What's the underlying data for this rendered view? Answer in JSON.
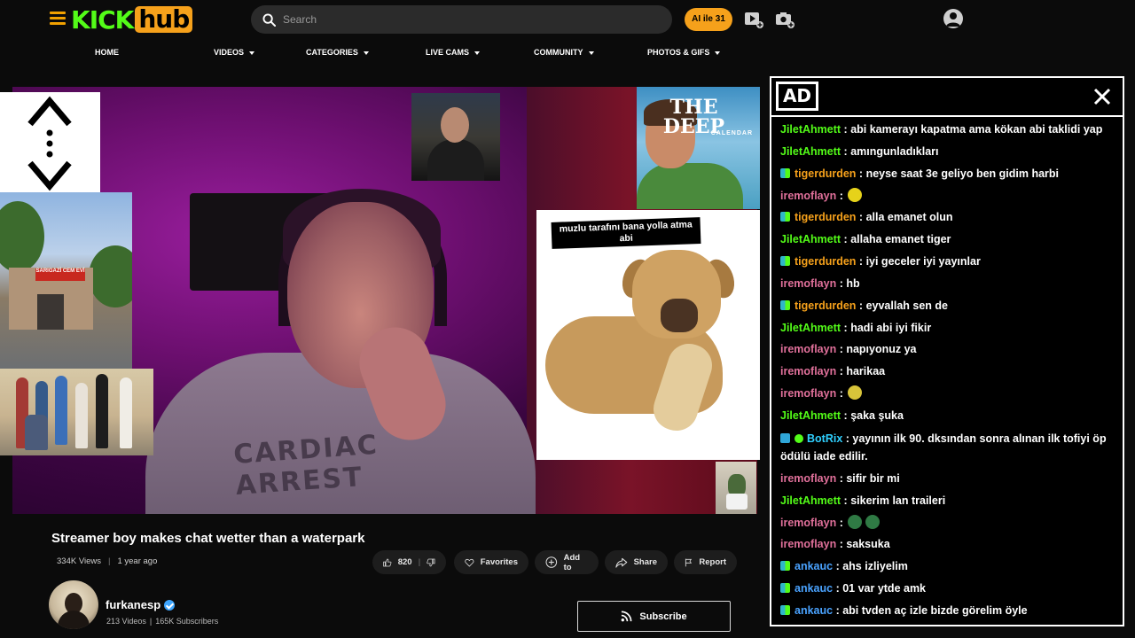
{
  "header": {
    "logo_kick": "KICK",
    "logo_hub": "hub",
    "search_placeholder": "Search",
    "cta_label": "AI ile 31",
    "nav": [
      {
        "label": "HOME",
        "has_caret": false
      },
      {
        "label": "VIDEOS",
        "has_caret": true
      },
      {
        "label": "CATEGORIES",
        "has_caret": true
      },
      {
        "label": "LIVE CAMS",
        "has_caret": true
      },
      {
        "label": "COMMUNITY",
        "has_caret": true
      },
      {
        "label": "PHOTOS & GIFS",
        "has_caret": true
      }
    ],
    "icons": [
      "hamburger-icon",
      "search-icon",
      "video-upload-icon",
      "camera-upload-icon",
      "user-avatar-icon"
    ]
  },
  "video": {
    "shirt_text": "CARDIAC ARREST",
    "overlays": {
      "building_sign": "SARIGAZİ CEM EVİ",
      "poster_title": "THE DEEP",
      "poster_subtitle": "CALENDAR",
      "meme_caption": "muzlu tarafını bana yolla atma abi"
    }
  },
  "details": {
    "title": "Streamer boy makes chat wetter than a waterpark",
    "views": "334K Views",
    "age": "1 year ago",
    "likes": "820",
    "actions": {
      "favorites": "Favorites",
      "add_to": "Add to",
      "share": "Share",
      "report": "Report"
    },
    "channel": {
      "name": "furkanesp",
      "videos": "213 Videos",
      "subscribers": "165K Subscribers",
      "subscribe_label": "Subscribe"
    }
  },
  "chat": {
    "ad_label": "AD",
    "colors": {
      "JiletAhmett": "#53fc18",
      "tigerdurden": "#f6a11b",
      "iremoflayn": "#e0709a",
      "BotRix": "#2fd0ff",
      "ankauc": "#4aa3ff"
    },
    "messages": [
      {
        "user": "JiletAhmett",
        "text": "abi kamerayı kapatma ama kökan abi taklidi yap",
        "badge": ""
      },
      {
        "user": "JiletAhmett",
        "text": "amıngunladıkları",
        "badge": ""
      },
      {
        "user": "tigerdurden",
        "text": "neyse saat 3e geliyo ben gidim harbi",
        "badge": "sub"
      },
      {
        "user": "iremoflayn",
        "text": "",
        "badge": "",
        "emotes": [
          "yellow"
        ]
      },
      {
        "user": "tigerdurden",
        "text": "alla emanet olun",
        "badge": "sub"
      },
      {
        "user": "JiletAhmett",
        "text": "allaha emanet tiger",
        "badge": ""
      },
      {
        "user": "tigerdurden",
        "text": "iyi geceler iyi yayınlar",
        "badge": "sub"
      },
      {
        "user": "iremoflayn",
        "text": "hb",
        "badge": ""
      },
      {
        "user": "tigerdurden",
        "text": "eyvallah sen de",
        "badge": "sub"
      },
      {
        "user": "JiletAhmett",
        "text": "hadi abi iyi fikir",
        "badge": ""
      },
      {
        "user": "iremoflayn",
        "text": "napıyonuz ya",
        "badge": ""
      },
      {
        "user": "iremoflayn",
        "text": "harikaa",
        "badge": ""
      },
      {
        "user": "iremoflayn",
        "text": "",
        "badge": "",
        "emotes": [
          "corn"
        ]
      },
      {
        "user": "JiletAhmett",
        "text": "şaka şuka",
        "badge": ""
      },
      {
        "user": "BotRix",
        "text": "yayının ilk 90. dksından sonra alınan ilk tofiyi öp ödülü iade edilir.",
        "badge": "bot"
      },
      {
        "user": "iremoflayn",
        "text": "sifir bir mi",
        "badge": ""
      },
      {
        "user": "JiletAhmett",
        "text": "sikerim lan traileri",
        "badge": ""
      },
      {
        "user": "iremoflayn",
        "text": "",
        "badge": "",
        "emotes": [
          "zombie",
          "zombie"
        ]
      },
      {
        "user": "iremoflayn",
        "text": "saksuka",
        "badge": ""
      },
      {
        "user": "ankauc",
        "text": "ahs izliyelim",
        "badge": "sub"
      },
      {
        "user": "ankauc",
        "text": "01 var ytde amk",
        "badge": "sub"
      },
      {
        "user": "ankauc",
        "text": "abi tvden aç izle bizde görelim öyle",
        "badge": "sub"
      }
    ]
  }
}
